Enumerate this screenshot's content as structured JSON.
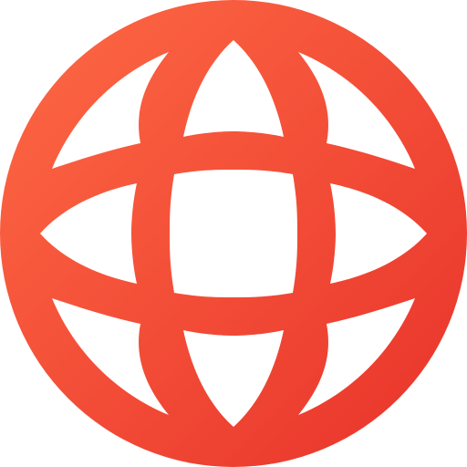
{
  "icon": {
    "name": "globe-icon",
    "gradient": {
      "start": "#fe6a45",
      "end": "#e8322a"
    }
  }
}
